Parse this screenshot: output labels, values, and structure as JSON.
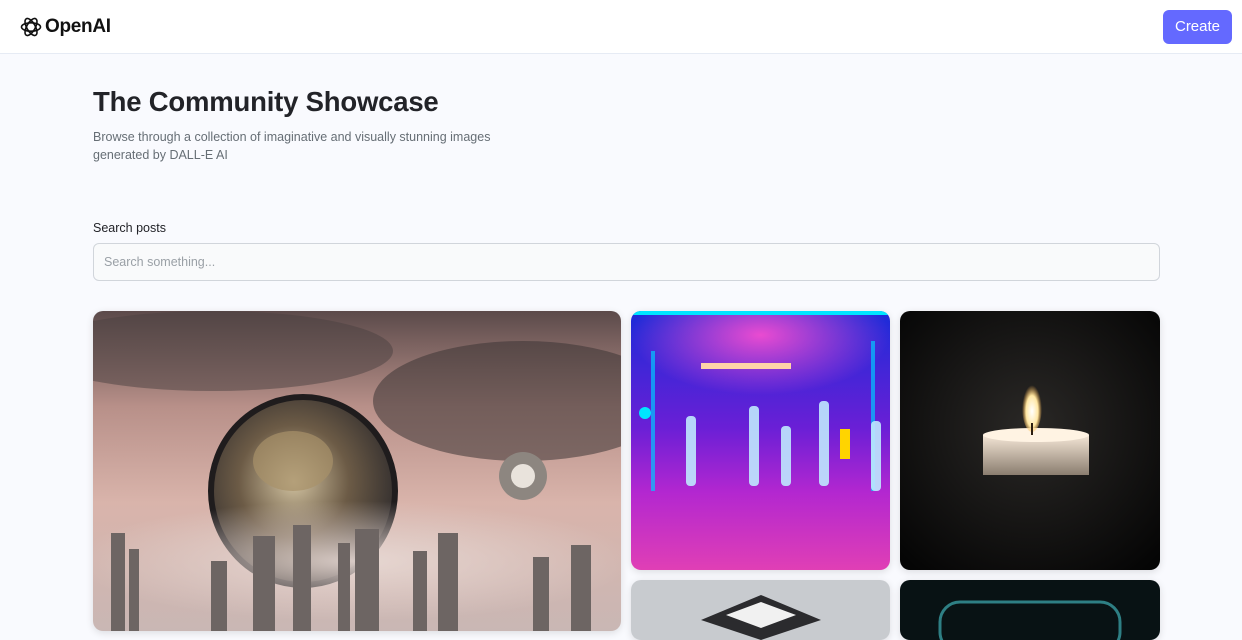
{
  "header": {
    "logo_text": "OpenAI",
    "create_label": "Create",
    "accent_color": "#6469ff"
  },
  "hero": {
    "title": "The Community Showcase",
    "subtitle": "Browse through a collection of imaginative and visually stunning images generated by DALL-E AI"
  },
  "search": {
    "label": "Search posts",
    "placeholder": "Search something...",
    "value": ""
  },
  "gallery": {
    "items": [
      {
        "subject": "futuristic-city-portal-image"
      },
      {
        "subject": "neon-dancers-image"
      },
      {
        "subject": "candle-image"
      },
      {
        "subject": "cube-image"
      },
      {
        "subject": "glowing-ring-image"
      }
    ]
  }
}
